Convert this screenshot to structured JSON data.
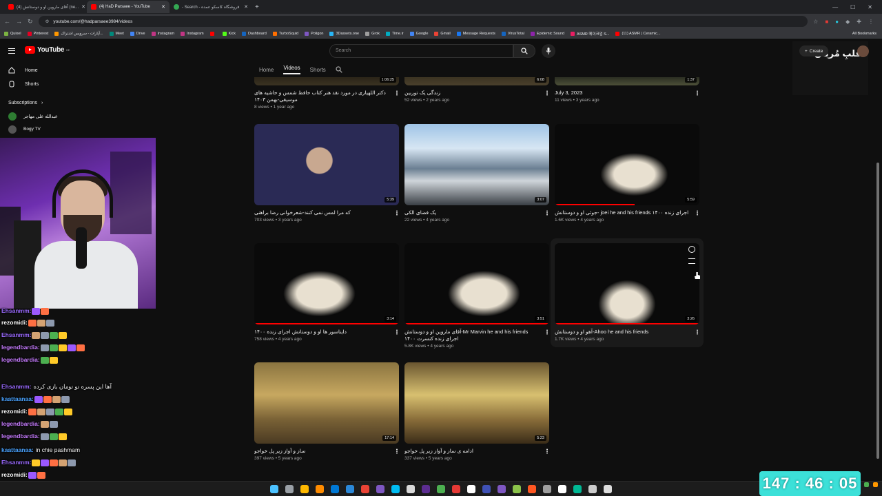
{
  "browser": {
    "tabs": [
      {
        "label": "(4) آقای ماروین او و دوستانش (ne...",
        "color": "#ff0000",
        "active": false
      },
      {
        "label": "(4) HaD Parsaee - YouTube",
        "color": "#ff0000",
        "active": true
      },
      {
        "label": "- Search - فروشگاه کاسکو عمده",
        "color": "#34a853",
        "active": false
      }
    ],
    "new_tab": "+",
    "url": "youtube.com/@hadparsaee3984/videos",
    "bookmarks": [
      "Quixel",
      "Pinterest",
      "آپارات - سرویس اشتراک...",
      "Meet",
      "Drive",
      "Instagram",
      "Instagram",
      "",
      "Kick",
      "Dashboard",
      "TurboSquid",
      "Poligon",
      "3Dassets.one",
      "Grok",
      "Time.ir",
      "Google",
      "Gmail",
      "Message Requests",
      "VirusTotal",
      "Epidemic Sound",
      "ASMR 메이크업 S...",
      "(11) ASMR | Ceramic..."
    ],
    "all_bookmarks": "All Bookmarks"
  },
  "youtube": {
    "logo": "YouTube",
    "region": "DE",
    "search_placeholder": "Search",
    "create_label": "Create",
    "overlay_title": "قلبِ مُربان",
    "sidebar": {
      "items": [
        {
          "label": "Home"
        },
        {
          "label": "Shorts"
        }
      ],
      "subscriptions_title": "Subscriptions",
      "subs": [
        "عبدالله علی مهاجر",
        "Bogy TV"
      ]
    },
    "channel_tabs": [
      "Home",
      "Videos",
      "Shorts"
    ],
    "videos": [
      {
        "title": "دکتر اللهیاری در مورد نقد هنر کتاب حافظ شمس و حاشیه های موسیقی-بهمن ۱۴۰۳",
        "views": "8 views",
        "age": "1 year ago",
        "duration": "1:06:25",
        "progress": 0
      },
      {
        "title": "زندگی یک توربین",
        "views": "52 views",
        "age": "2 years ago",
        "duration": "6:08",
        "progress": 0
      },
      {
        "title": "July 3, 2023",
        "views": "11 views",
        "age": "3 years ago",
        "duration": "1:37",
        "progress": 0
      },
      {
        "title": "که مرا لمس نمی کنند-شعرخوانی رضا براهنی",
        "views": "703 views",
        "age": "3 years ago",
        "duration": "5:39",
        "progress": 0
      },
      {
        "title": "یک فضای الکی",
        "views": "22 views",
        "age": "4 years ago",
        "duration": "3:07",
        "progress": 0
      },
      {
        "title": "جوئی او و دوستانش- joei he and his friends اجرای زنده ۱۴۰۰",
        "views": "1.6K views",
        "age": "4 years ago",
        "duration": "5:59",
        "progress": 0.55
      },
      {
        "title": "دایناسور ها او و دوستانش اجرای زنده ۱۴۰۰",
        "views": "758 views",
        "age": "4 years ago",
        "duration": "3:14",
        "progress": 1.0
      },
      {
        "title": "آقای ماروین او و دوستانش-Mr Marvin he and his friends اجرای زنده کنسرت ۱۴۰۰",
        "views": "5.8K views",
        "age": "4 years ago",
        "duration": "3:51",
        "progress": 1.0
      },
      {
        "title": "آهو او و دوستانش-Ahoo he and his friends",
        "views": "1.7K views",
        "age": "4 years ago",
        "duration": "3:26",
        "progress": 1.0
      },
      {
        "title": "ساز و آواز زیر پل خواجو",
        "views": "397 views",
        "age": "5 years ago",
        "duration": "17:14",
        "progress": 0
      },
      {
        "title": "ادامه ی ساز و آواز زیر پل خواجو",
        "views": "337 views",
        "age": "5 years ago",
        "duration": "5:23",
        "progress": 0
      }
    ]
  },
  "chat": [
    {
      "user": "Ehsanmm:",
      "text": "",
      "color": "#9b6bff"
    },
    {
      "user": "rezomidi:",
      "text": "",
      "color": "#ffffff"
    },
    {
      "user": "Ehsanmm:",
      "text": "",
      "color": "#9b6bff"
    },
    {
      "user": "legendbardia:",
      "text": "",
      "color": "#c77dff"
    },
    {
      "user": "legendbardia:",
      "text": "",
      "color": "#c77dff"
    },
    {
      "user": "Ehsanmm:",
      "text": "آها این پسره تو تومان بازی کرده",
      "color": "#9b6bff"
    },
    {
      "user": "kaattaanaa:",
      "text": "",
      "color": "#4aa3ff"
    },
    {
      "user": "rezomidi:",
      "text": "",
      "color": "#ffffff"
    },
    {
      "user": "legendbardia:",
      "text": "",
      "color": "#c77dff"
    },
    {
      "user": "legendbardia:",
      "text": "",
      "color": "#c77dff"
    },
    {
      "user": "kaattaanaa:",
      "text": "in chie pashmam",
      "color": "#4aa3ff"
    },
    {
      "user": "Ehsanmm:",
      "text": "",
      "color": "#9b6bff"
    },
    {
      "user": "rezomidi:",
      "text": "",
      "color": "#ffffff"
    },
    {
      "user": "legendbardia:",
      "text": "",
      "color": "#c77dff"
    }
  ],
  "timer": "147 : 46 : 05",
  "colors": {
    "accent": "#ff0000",
    "timer": "#3ce0d8"
  }
}
